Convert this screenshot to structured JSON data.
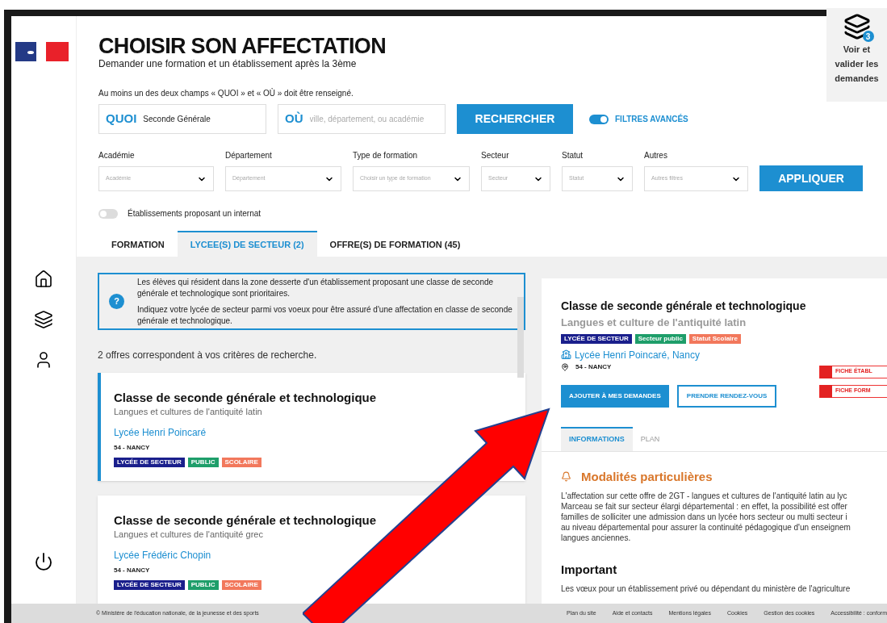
{
  "header": {
    "title": "CHOISIR SON AFFECTATION",
    "subtitle": "Demander une formation et un établissement après la 3ème"
  },
  "requests": {
    "count": "3",
    "label": "Voir et valider les demandes"
  },
  "search": {
    "hint": "Au moins un des deux champs « QUOI » et « OÙ » doit être renseigné.",
    "what": {
      "label": "QUOI",
      "value": "Seconde Générale"
    },
    "where": {
      "label": "OÙ",
      "placeholder": "ville, département, ou académie"
    },
    "button": "RECHERCHER",
    "advanced": {
      "label": "FILTRES AVANCÉS",
      "on": true
    }
  },
  "filters": [
    {
      "label": "Académie",
      "placeholder": "Académie"
    },
    {
      "label": "Département",
      "placeholder": "Département"
    },
    {
      "label": "Type de formation",
      "placeholder": "Choisir un type de formation"
    },
    {
      "label": "Secteur",
      "placeholder": "Secteur"
    },
    {
      "label": "Statut",
      "placeholder": "Statut"
    },
    {
      "label": "Autres",
      "placeholder": "Autres filtres"
    }
  ],
  "apply_button": "APPLIQUER",
  "internat": {
    "label": "Établissements proposant un internat",
    "on": false
  },
  "tabs": [
    {
      "label": "FORMATION",
      "selected": false
    },
    {
      "label": "LYCEE(S) DE SECTEUR (2)",
      "selected": true
    },
    {
      "label": "OFFRE(S) DE FORMATION (45)",
      "selected": false
    }
  ],
  "info": {
    "help_icon": "?",
    "paragraphs": [
      "Les élèves qui résident dans la zone desserte d'un établissement proposant une classe de seconde générale et technologique sont prioritaires.",
      "Indiquez votre lycée de secteur parmi vos voeux pour être assuré d'une affectation en classe de seconde générale et technologique."
    ]
  },
  "results_count": "2 offres correspondent à vos critères de recherche.",
  "offers": [
    {
      "title": "Classe de seconde générale et technologique",
      "subtitle": "Langues et cultures de l'antiquité latin",
      "school": "Lycée Henri Poincaré",
      "place": "54 - NANCY",
      "selected": true,
      "tags": [
        {
          "label": "LYCÉE DE SECTEUR",
          "color": "#1a1f8c"
        },
        {
          "label": "PUBLIC",
          "color": "#1e9e6a"
        },
        {
          "label": "SCOLAIRE",
          "color": "#f2785c"
        }
      ]
    },
    {
      "title": "Classe de seconde générale et technologique",
      "subtitle": "Langues et cultures de l'antiquité grec",
      "school": "Lycée Frédéric Chopin",
      "place": "54 - NANCY",
      "selected": false,
      "tags": [
        {
          "label": "LYCÉE DE SECTEUR",
          "color": "#1a1f8c"
        },
        {
          "label": "PUBLIC",
          "color": "#1e9e6a"
        },
        {
          "label": "SCOLAIRE",
          "color": "#f2785c"
        }
      ]
    }
  ],
  "detail": {
    "title": "Classe de seconde générale et technologique",
    "subtitle": "Langues et culture de l'antiquité latin",
    "tags": [
      {
        "label": "LYCÉE DE SECTEUR",
        "color": "#1a1f8c"
      },
      {
        "label": "Secteur public",
        "color": "#1e9e6a"
      },
      {
        "label": "Statut Scolaire",
        "color": "#f2785c"
      }
    ],
    "school": "Lycée Henri Poincaré, Nancy",
    "place": "54 - NANCY",
    "add_button": "AJOUTER À MES DEMANDES",
    "appointment_button": "PRENDRE RENDEZ-VOUS",
    "sheets": [
      "FICHE ÉTABL",
      "FICHE FORM"
    ],
    "tabs": [
      {
        "label": "INFORMATIONS",
        "selected": true
      },
      {
        "label": "PLAN",
        "selected": false
      }
    ],
    "notice_title": "Modalités particulières",
    "notice_lines": [
      "L'affectation sur cette offre de 2GT - langues et cultures de l'antiquité latin au lyc",
      "Marceau se fait sur secteur élargi départemental : en effet, la possibilité est offer",
      "familles de solliciter une admission dans un lycée hors secteur ou multi secteur i",
      "au niveau départemental pour assurer la continuité pédagogique d'un enseignem",
      "langues anciennes."
    ],
    "important_title": "Important",
    "important_line": "Les vœux pour un établissement privé ou dépendant du ministère de l'agriculture"
  },
  "footer": {
    "copyright": "© Ministère de l'éducation nationale, de la jeunesse et des sports",
    "links": [
      "Plan du site",
      "Aide et contacts",
      "Mentions légales",
      "Cookies",
      "Gestion des cookies",
      "Accessibilité : conform"
    ]
  }
}
